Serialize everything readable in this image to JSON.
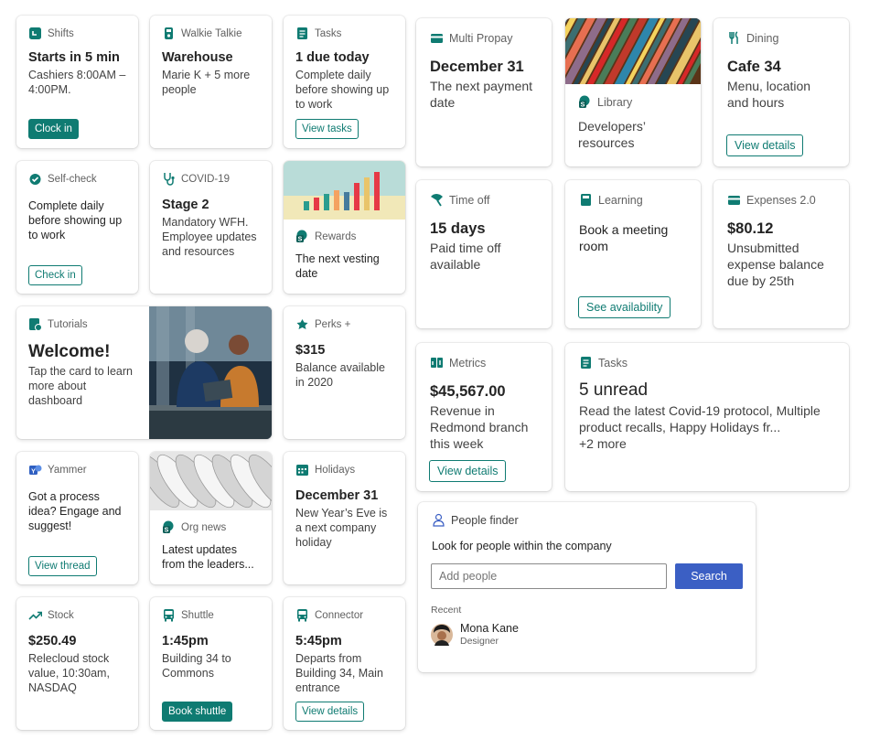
{
  "colors": {
    "accent": "#0f7b72",
    "primary_blue": "#3b5fc4",
    "text": "#242424"
  },
  "shifts": {
    "header": "Shifts",
    "title": "Starts in 5 min",
    "body": "Cashiers 8:00AM – 4:00PM.",
    "button": "Clock in",
    "icon": "calendar-icon"
  },
  "walkie": {
    "header": "Walkie Talkie",
    "title": "Warehouse",
    "body": "Marie K + 5 more people",
    "icon": "walkie-talkie-icon"
  },
  "tasks_small": {
    "header": "Tasks",
    "title": "1 due today",
    "body": "Complete daily before showing up to work",
    "button": "View tasks",
    "icon": "task-list-icon"
  },
  "multi_propay": {
    "header": "Multi Propay",
    "title": "December 31",
    "body": "The next payment date",
    "icon": "payment-icon"
  },
  "library": {
    "header": "Library",
    "body": "Developers’ resources",
    "icon": "sharepoint-icon"
  },
  "dining": {
    "header": "Dining",
    "title": "Cafe 34",
    "body": "Menu, location and hours",
    "button": "View details",
    "icon": "fork-knife-icon"
  },
  "selfcheck": {
    "header": "Self-check",
    "body": "Complete daily before showing up to work",
    "button": "Check in",
    "icon": "self-check-icon"
  },
  "covid": {
    "header": "COVID-19",
    "title": "Stage 2",
    "body": "Mandatory WFH. Employee updates and resources",
    "icon": "stethoscope-icon"
  },
  "rewards": {
    "header": "Rewards",
    "body": "The next vesting date",
    "icon": "sharepoint-icon"
  },
  "timeoff": {
    "header": "Time off",
    "title": "15 days",
    "body": "Paid time off available",
    "icon": "time-off-icon"
  },
  "learning": {
    "header": "Learning",
    "body": "Book a meeting room",
    "button": "See availability",
    "icon": "book-icon"
  },
  "expenses": {
    "header": "Expenses 2.0",
    "title": "$80.12",
    "body": "Unsubmitted expense balance due by 25th",
    "icon": "card-icon"
  },
  "tutorials": {
    "header": "Tutorials",
    "title": "Welcome!",
    "body": "Tap the card to learn more about dashboard",
    "icon": "tutorial-icon"
  },
  "perks": {
    "header": "Perks +",
    "title": "$315",
    "body": "Balance available in 2020",
    "icon": "perks-icon"
  },
  "metrics": {
    "header": "Metrics",
    "title": "$45,567.00",
    "body": "Revenue in Redmond branch this week",
    "button": "View details",
    "icon": "metrics-icon"
  },
  "tasks_large": {
    "header": "Tasks",
    "title": "5 unread",
    "body": "Read the latest Covid-19 protocol, Multiple product recalls, Happy Holidays fr...",
    "more": "+2 more",
    "icon": "task-list-icon"
  },
  "yammer": {
    "header": "Yammer",
    "body": "Got a process idea? Engage and suggest!",
    "button": "View thread",
    "icon": "yammer-icon"
  },
  "orgnews": {
    "header": "Org news",
    "body": "Latest updates from the leaders...",
    "icon": "sharepoint-icon"
  },
  "holidays": {
    "header": "Holidays",
    "title": "December 31",
    "body": "New Year’s Eve is a next company holiday",
    "icon": "calendar-grid-icon"
  },
  "people": {
    "header": "People finder",
    "prompt": "Look for people within the company",
    "placeholder": "Add people",
    "search": "Search",
    "recent_label": "Recent",
    "recent_name": "Mona Kane",
    "recent_role": "Designer",
    "icon": "person-icon"
  },
  "stock": {
    "header": "Stock",
    "title": "$250.49",
    "body": "Relecloud stock value, 10:30am, NASDAQ",
    "icon": "trend-up-icon"
  },
  "shuttle": {
    "header": "Shuttle",
    "title": "1:45pm",
    "body": "Building 34 to Commons",
    "button": "Book shuttle",
    "icon": "bus-icon"
  },
  "connector": {
    "header": "Connector",
    "title": "5:45pm",
    "body": "Departs from Building 34, Main entrance",
    "button": "View details",
    "icon": "bus-icon"
  }
}
